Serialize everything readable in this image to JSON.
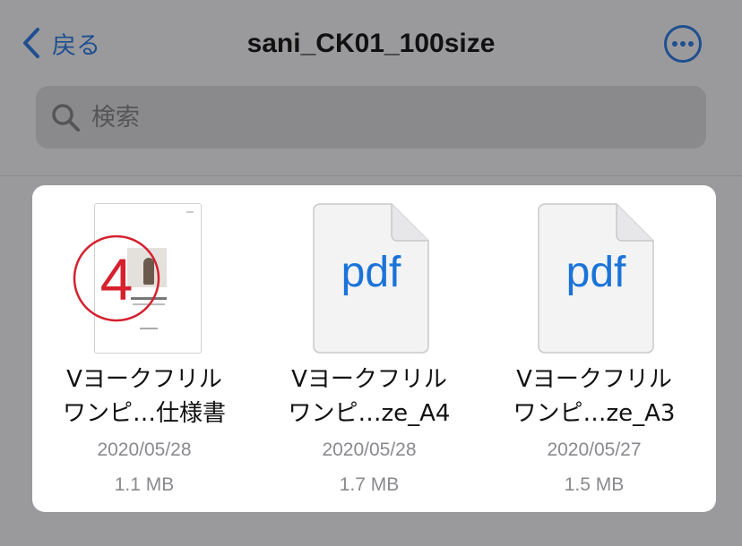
{
  "nav": {
    "back_label": "戻る",
    "title": "sani_CK01_100size",
    "more_icon": "ellipsis-circle-icon",
    "accent_color": "#1f4f8f"
  },
  "search": {
    "placeholder": "検索",
    "icon": "magnifier-icon"
  },
  "files": [
    {
      "name_line1": "Vヨークフリル",
      "name_line2": "ワンピ…仕様書",
      "date": "2020/05/28",
      "size": "1.1 MB",
      "thumbnail": "document-preview",
      "annotation": "4"
    },
    {
      "name_line1": "Vヨークフリル",
      "name_line2": "ワンピ…ze_A4",
      "date": "2020/05/28",
      "size": "1.7 MB",
      "thumbnail": "pdf-icon",
      "icon_text": "pdf"
    },
    {
      "name_line1": "Vヨークフリル",
      "name_line2": "ワンピ…ze_A3",
      "date": "2020/05/27",
      "size": "1.5 MB",
      "thumbnail": "pdf-icon",
      "icon_text": "pdf"
    }
  ],
  "colors": {
    "pdf_text": "#1a73d9",
    "annotation_red": "#d6202e",
    "meta_gray": "#8a8a8e"
  }
}
